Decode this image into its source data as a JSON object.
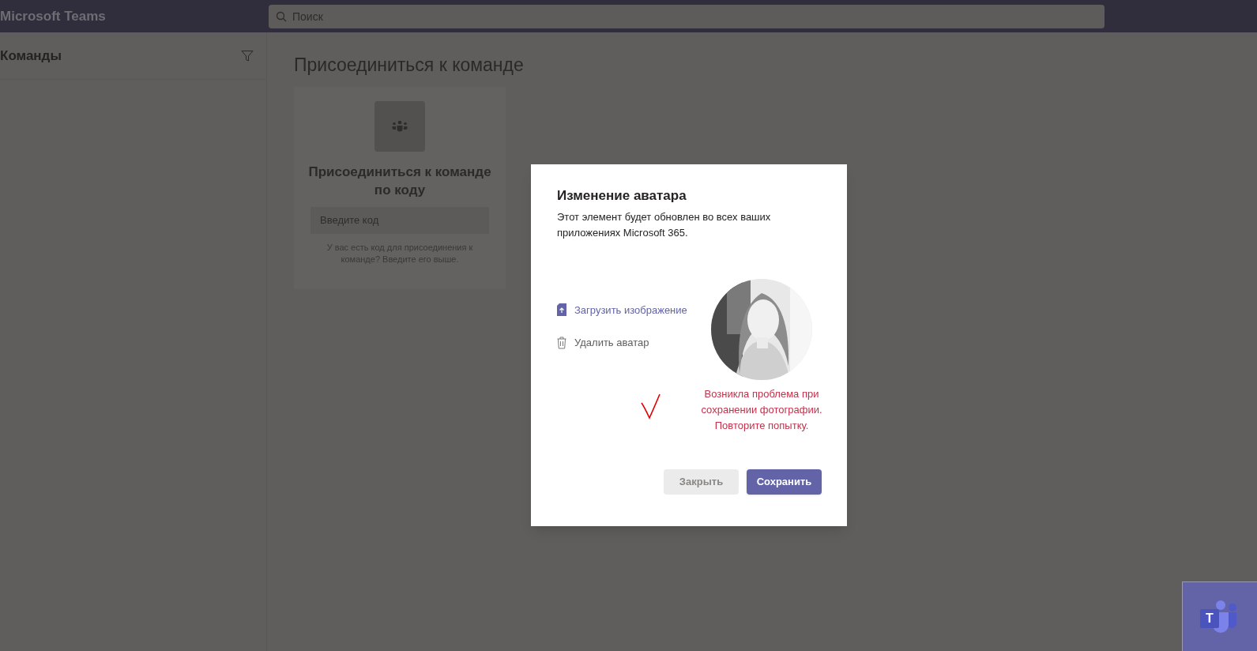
{
  "app_bar": {
    "title": "Microsoft Teams",
    "search": {
      "placeholder": "Поиск"
    }
  },
  "sidebar": {
    "title": "Команды"
  },
  "main": {
    "title": "Присоединиться к команде",
    "join_card": {
      "title": "Присоединиться к команде по коду",
      "code_field": {
        "placeholder": "Введите код"
      },
      "hint": "У вас есть код для присоединения к команде? Введите его выше."
    }
  },
  "dialog": {
    "title": "Изменение аватара",
    "description": "Этот элемент будет обновлен во всех ваших приложениях Microsoft 365.",
    "actions": [
      {
        "kind": "upload",
        "label": "Загрузить изображение"
      },
      {
        "kind": "delete",
        "label": "Удалить аватар"
      }
    ],
    "error": "Возникла проблема при сохранении фотографии. Повторите попытку.",
    "buttons": [
      {
        "label": "Закрыть",
        "disabled": true,
        "primary": false
      },
      {
        "label": "Сохранить",
        "disabled": false,
        "primary": true
      }
    ]
  },
  "teams_badge": {
    "letter": "T"
  }
}
